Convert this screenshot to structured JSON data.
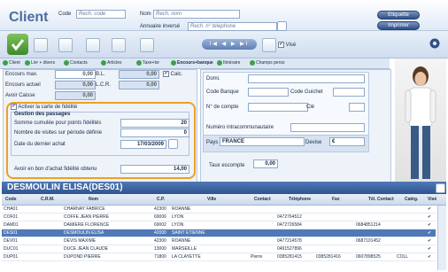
{
  "header": {
    "title": "Client",
    "code_label": "Code",
    "code_placeholder": "Rech. code",
    "nom_label": "Nom",
    "nom_placeholder": "Rech. nom",
    "annuaire_label": "Annuaire inversé",
    "annuaire_placeholder": "Rech. n° telephone",
    "etiquette_label": "Etiquette",
    "imprimer_label": "Imprimer"
  },
  "toolbar": {
    "nav_label": "I◀ ◀ ▶ ▶I",
    "vise_label": "Visé"
  },
  "tabs": [
    "Client",
    "Livr + divers",
    "Contacts",
    "Articles",
    "Taxe+tsr",
    "Encours+banque",
    "Itinéraire",
    "Champs perso"
  ],
  "encours": {
    "encours_max_label": "Encours max.",
    "encours_max_value": "0,00",
    "bl_label": "B.L.",
    "bl_value": "0,00",
    "calc_label": "Calc.",
    "encours_actuel_label": "Encours actuel",
    "encours_actuel_value": "0,00",
    "lcr_label": "L.C.R.",
    "lcr_value": "0,00",
    "avoir_caisse_label": "Avoir Caisse",
    "avoir_caisse_value": "0,00"
  },
  "fidelite": {
    "activer_label": "Activer la carte de fidélité",
    "gestion_label": "Gestion des passages",
    "somme_label": "Somme cumulée pour points fidélités",
    "somme_value": "20",
    "visites_label": "Nombre de visites sur période définie",
    "visites_value": "0",
    "date_label": "Date du dernier achat",
    "date_value": "17/03/2009",
    "avoir_label": "Avoir en bon d'achat fidélité obtenu",
    "avoir_value": "14,00"
  },
  "banque": {
    "domi_label": "Domi.",
    "code_banque_label": "Code Banque",
    "code_guichet_label": "Code Guichet",
    "compte_label": "N° de compte",
    "cle_label": "Clé",
    "intracom_label": "Numéro intracommunautaire",
    "pays_label": "Pays",
    "pays_value": "FRANCE",
    "devise_label": "Devise",
    "devise_value": "€",
    "taux_label": "Taux escompte",
    "taux_value": "0,00"
  },
  "grid": {
    "title": "DESMOULIN ELISA(DES01)",
    "columns": [
      "Code",
      "C.R.M.",
      "Nom",
      "C.P.",
      "Ville",
      "Contact",
      "Téléphone",
      "Fax",
      "Tél. Contact",
      "Catég.",
      "Visé"
    ],
    "rows": [
      {
        "code": "CHA01",
        "nom": "CHARNAY FABRICE",
        "cp": "42300",
        "ville": "ROANNE",
        "contact": "",
        "tel": "",
        "fax": "",
        "telc": "",
        "categ": "",
        "vise": "✔"
      },
      {
        "code": "COF01",
        "nom": "COFFE JEAN PIERRE",
        "cp": "69006",
        "ville": "LYON",
        "contact": "",
        "tel": "0472764512",
        "fax": "",
        "telc": "",
        "categ": "",
        "vise": "✔"
      },
      {
        "code": "DAM01",
        "nom": "DAMIERE FLORENCE",
        "cp": "69002",
        "ville": "LYON",
        "contact": "",
        "tel": "0472726584",
        "fax": "",
        "telc": "0684851214",
        "categ": "",
        "vise": "✔"
      },
      {
        "code": "DES01",
        "nom": "DESMOULIN ELISA",
        "cp": "42000",
        "ville": "SAINT ETIENNE",
        "contact": "",
        "tel": "",
        "fax": "",
        "telc": "",
        "categ": "",
        "vise": "✔"
      },
      {
        "code": "DEV01",
        "nom": "DEVIS MAXIME",
        "cp": "42300",
        "ville": "ROANNE",
        "contact": "",
        "tel": "0477214578",
        "fax": "",
        "telc": "0687101452",
        "categ": "",
        "vise": "✔"
      },
      {
        "code": "DUC01",
        "nom": "DUCE JEAN CLAUDE",
        "cp": "13000",
        "ville": "MARSEILLE",
        "contact": "",
        "tel": "0491527896",
        "fax": "",
        "telc": "",
        "categ": "",
        "vise": "✔"
      },
      {
        "code": "DUP01",
        "nom": "DUPOND PIERRE",
        "cp": "71800",
        "ville": "LA CLAYETTE",
        "contact": "Pierre",
        "tel": "0385281415",
        "fax": "0385281416",
        "telc": "0607898525",
        "categ": "COLL",
        "vise": "✔"
      }
    ]
  }
}
